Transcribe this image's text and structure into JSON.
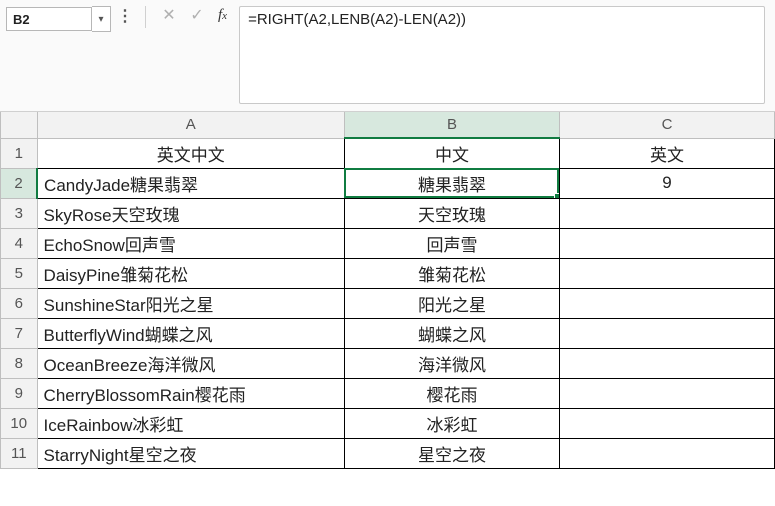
{
  "nameBox": {
    "value": "B2"
  },
  "formulaBar": {
    "value": "=RIGHT(A2,LENB(A2)-LEN(A2))"
  },
  "columns": [
    "A",
    "B",
    "C"
  ],
  "rows": [
    {
      "n": 1,
      "A": "英文中文",
      "B": "中文",
      "C": "英文",
      "alignA": "center",
      "alignC": "center"
    },
    {
      "n": 2,
      "A": "CandyJade糖果翡翠",
      "B": "糖果翡翠",
      "C": "9",
      "alignA": "left",
      "alignC": "center"
    },
    {
      "n": 3,
      "A": "SkyRose天空玫瑰",
      "B": "天空玫瑰",
      "C": "",
      "alignA": "left",
      "alignC": "center"
    },
    {
      "n": 4,
      "A": "EchoSnow回声雪",
      "B": "回声雪",
      "C": "",
      "alignA": "left",
      "alignC": "center"
    },
    {
      "n": 5,
      "A": "DaisyPine雏菊花松",
      "B": "雏菊花松",
      "C": "",
      "alignA": "left",
      "alignC": "center"
    },
    {
      "n": 6,
      "A": "SunshineStar阳光之星",
      "B": "阳光之星",
      "C": "",
      "alignA": "left",
      "alignC": "center"
    },
    {
      "n": 7,
      "A": "ButterflyWind蝴蝶之风",
      "B": "蝴蝶之风",
      "C": "",
      "alignA": "left",
      "alignC": "center"
    },
    {
      "n": 8,
      "A": "OceanBreeze海洋微风",
      "B": "海洋微风",
      "C": "",
      "alignA": "left",
      "alignC": "center"
    },
    {
      "n": 9,
      "A": "CherryBlossomRain樱花雨",
      "B": "樱花雨",
      "C": "",
      "alignA": "left",
      "alignC": "center"
    },
    {
      "n": 10,
      "A": "IceRainbow冰彩虹",
      "B": "冰彩虹",
      "C": "",
      "alignA": "left",
      "alignC": "center"
    },
    {
      "n": 11,
      "A": "StarryNight星空之夜",
      "B": "星空之夜",
      "C": "",
      "alignA": "left",
      "alignC": "center"
    }
  ],
  "activeCell": {
    "row": 2,
    "col": "B"
  }
}
